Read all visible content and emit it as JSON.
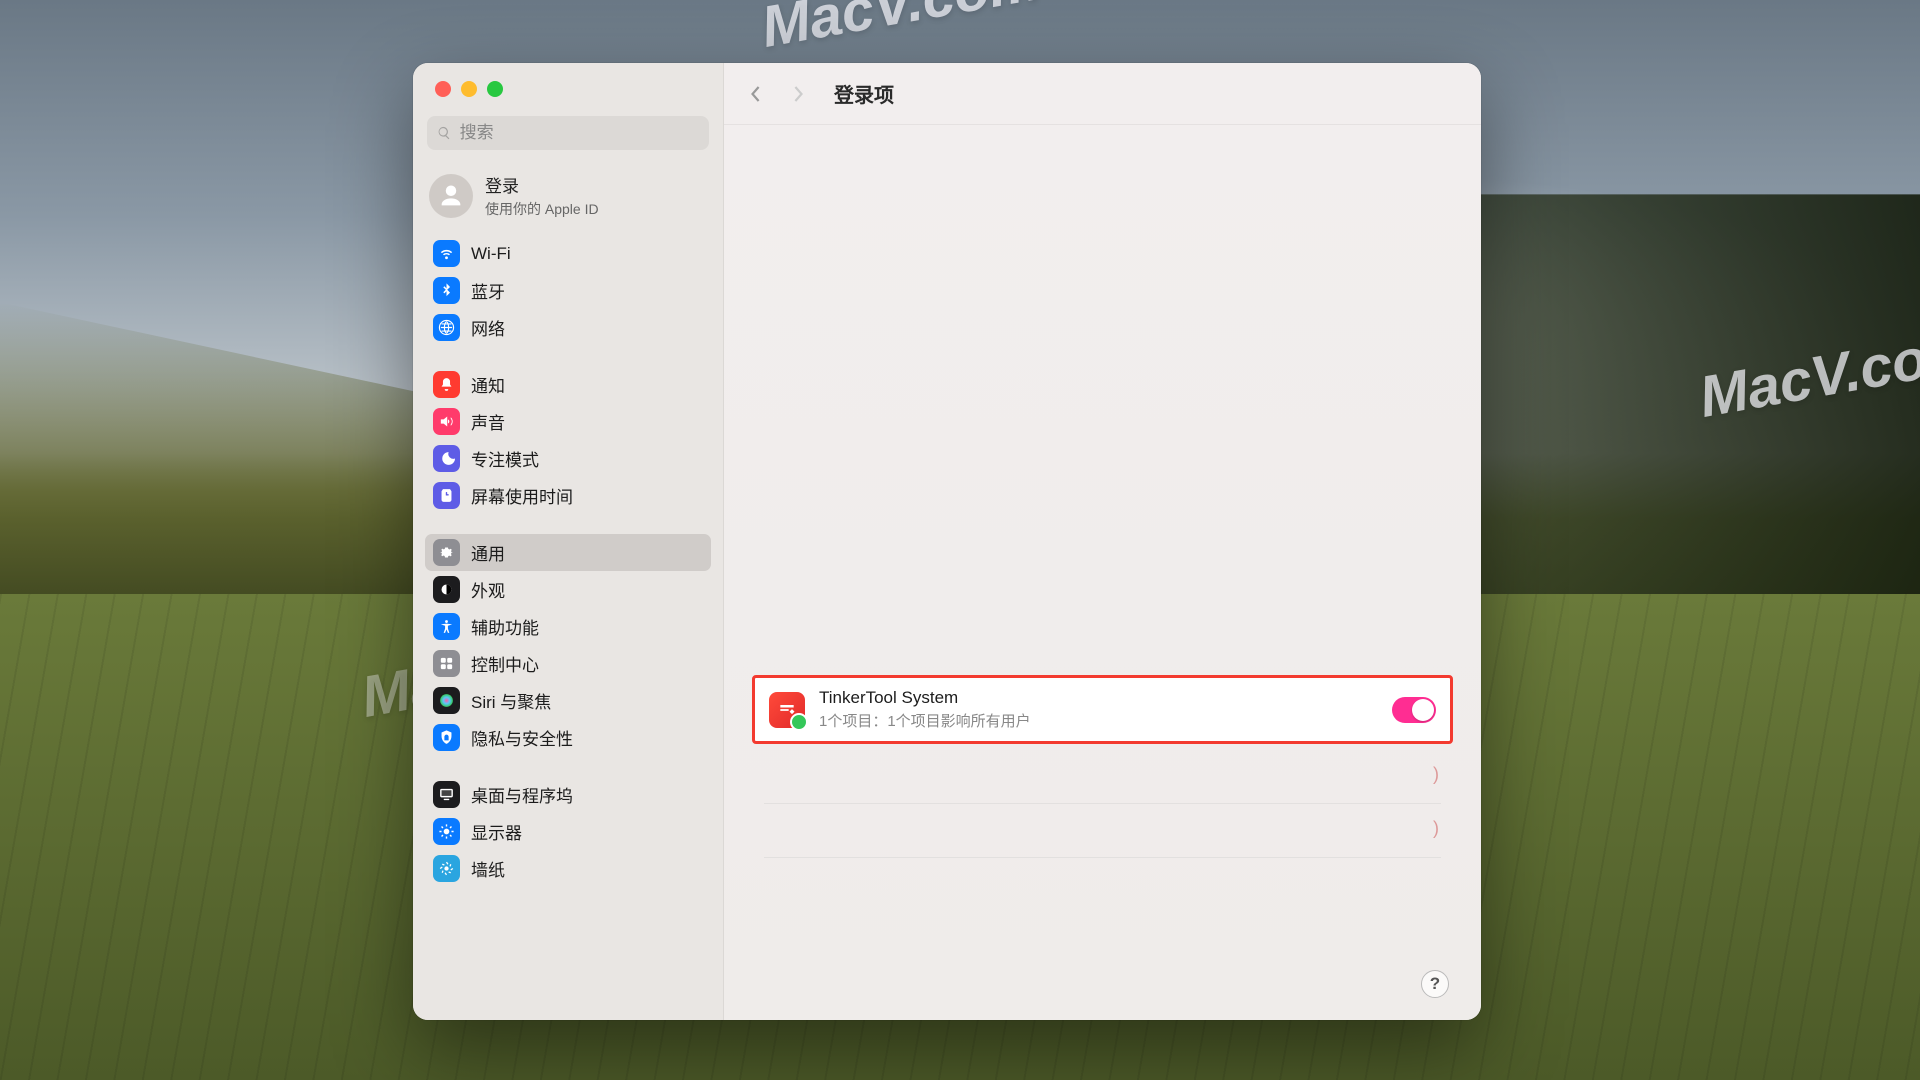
{
  "page_title": "登录项",
  "search": {
    "placeholder": "搜索"
  },
  "account": {
    "name": "登录",
    "sub": "使用你的 Apple ID"
  },
  "sidebar": {
    "groups": [
      {
        "items": [
          {
            "id": "wifi",
            "label": "Wi-Fi",
            "color": "#0a7aff"
          },
          {
            "id": "bluetooth",
            "label": "蓝牙",
            "color": "#0a7aff"
          },
          {
            "id": "network",
            "label": "网络",
            "color": "#0a7aff"
          }
        ]
      },
      {
        "items": [
          {
            "id": "notifications",
            "label": "通知",
            "color": "#ff3b30"
          },
          {
            "id": "sound",
            "label": "声音",
            "color": "#ff3b6b"
          },
          {
            "id": "focus",
            "label": "专注模式",
            "color": "#5e5ce6"
          },
          {
            "id": "screentime",
            "label": "屏幕使用时间",
            "color": "#5e5ce6"
          }
        ]
      },
      {
        "items": [
          {
            "id": "general",
            "label": "通用",
            "color": "#8e8e93",
            "selected": true
          },
          {
            "id": "appearance",
            "label": "外观",
            "color": "#1c1c1e"
          },
          {
            "id": "accessibility",
            "label": "辅助功能",
            "color": "#0a7aff"
          },
          {
            "id": "controlcenter",
            "label": "控制中心",
            "color": "#8e8e93"
          },
          {
            "id": "siri",
            "label": "Siri 与聚焦",
            "color": "#1c1c1e"
          },
          {
            "id": "privacy",
            "label": "隐私与安全性",
            "color": "#0a7aff"
          }
        ]
      },
      {
        "items": [
          {
            "id": "desktop",
            "label": "桌面与程序坞",
            "color": "#1c1c1e"
          },
          {
            "id": "displays",
            "label": "显示器",
            "color": "#0a7aff"
          },
          {
            "id": "wallpaper",
            "label": "墙纸",
            "color": "#2aa5e0"
          }
        ]
      }
    ]
  },
  "login_item": {
    "name": "TinkerTool System",
    "sub": "1个项目：1个项目影响所有用户",
    "enabled": true
  },
  "help_label": "?",
  "watermark_text": "MacV.com"
}
